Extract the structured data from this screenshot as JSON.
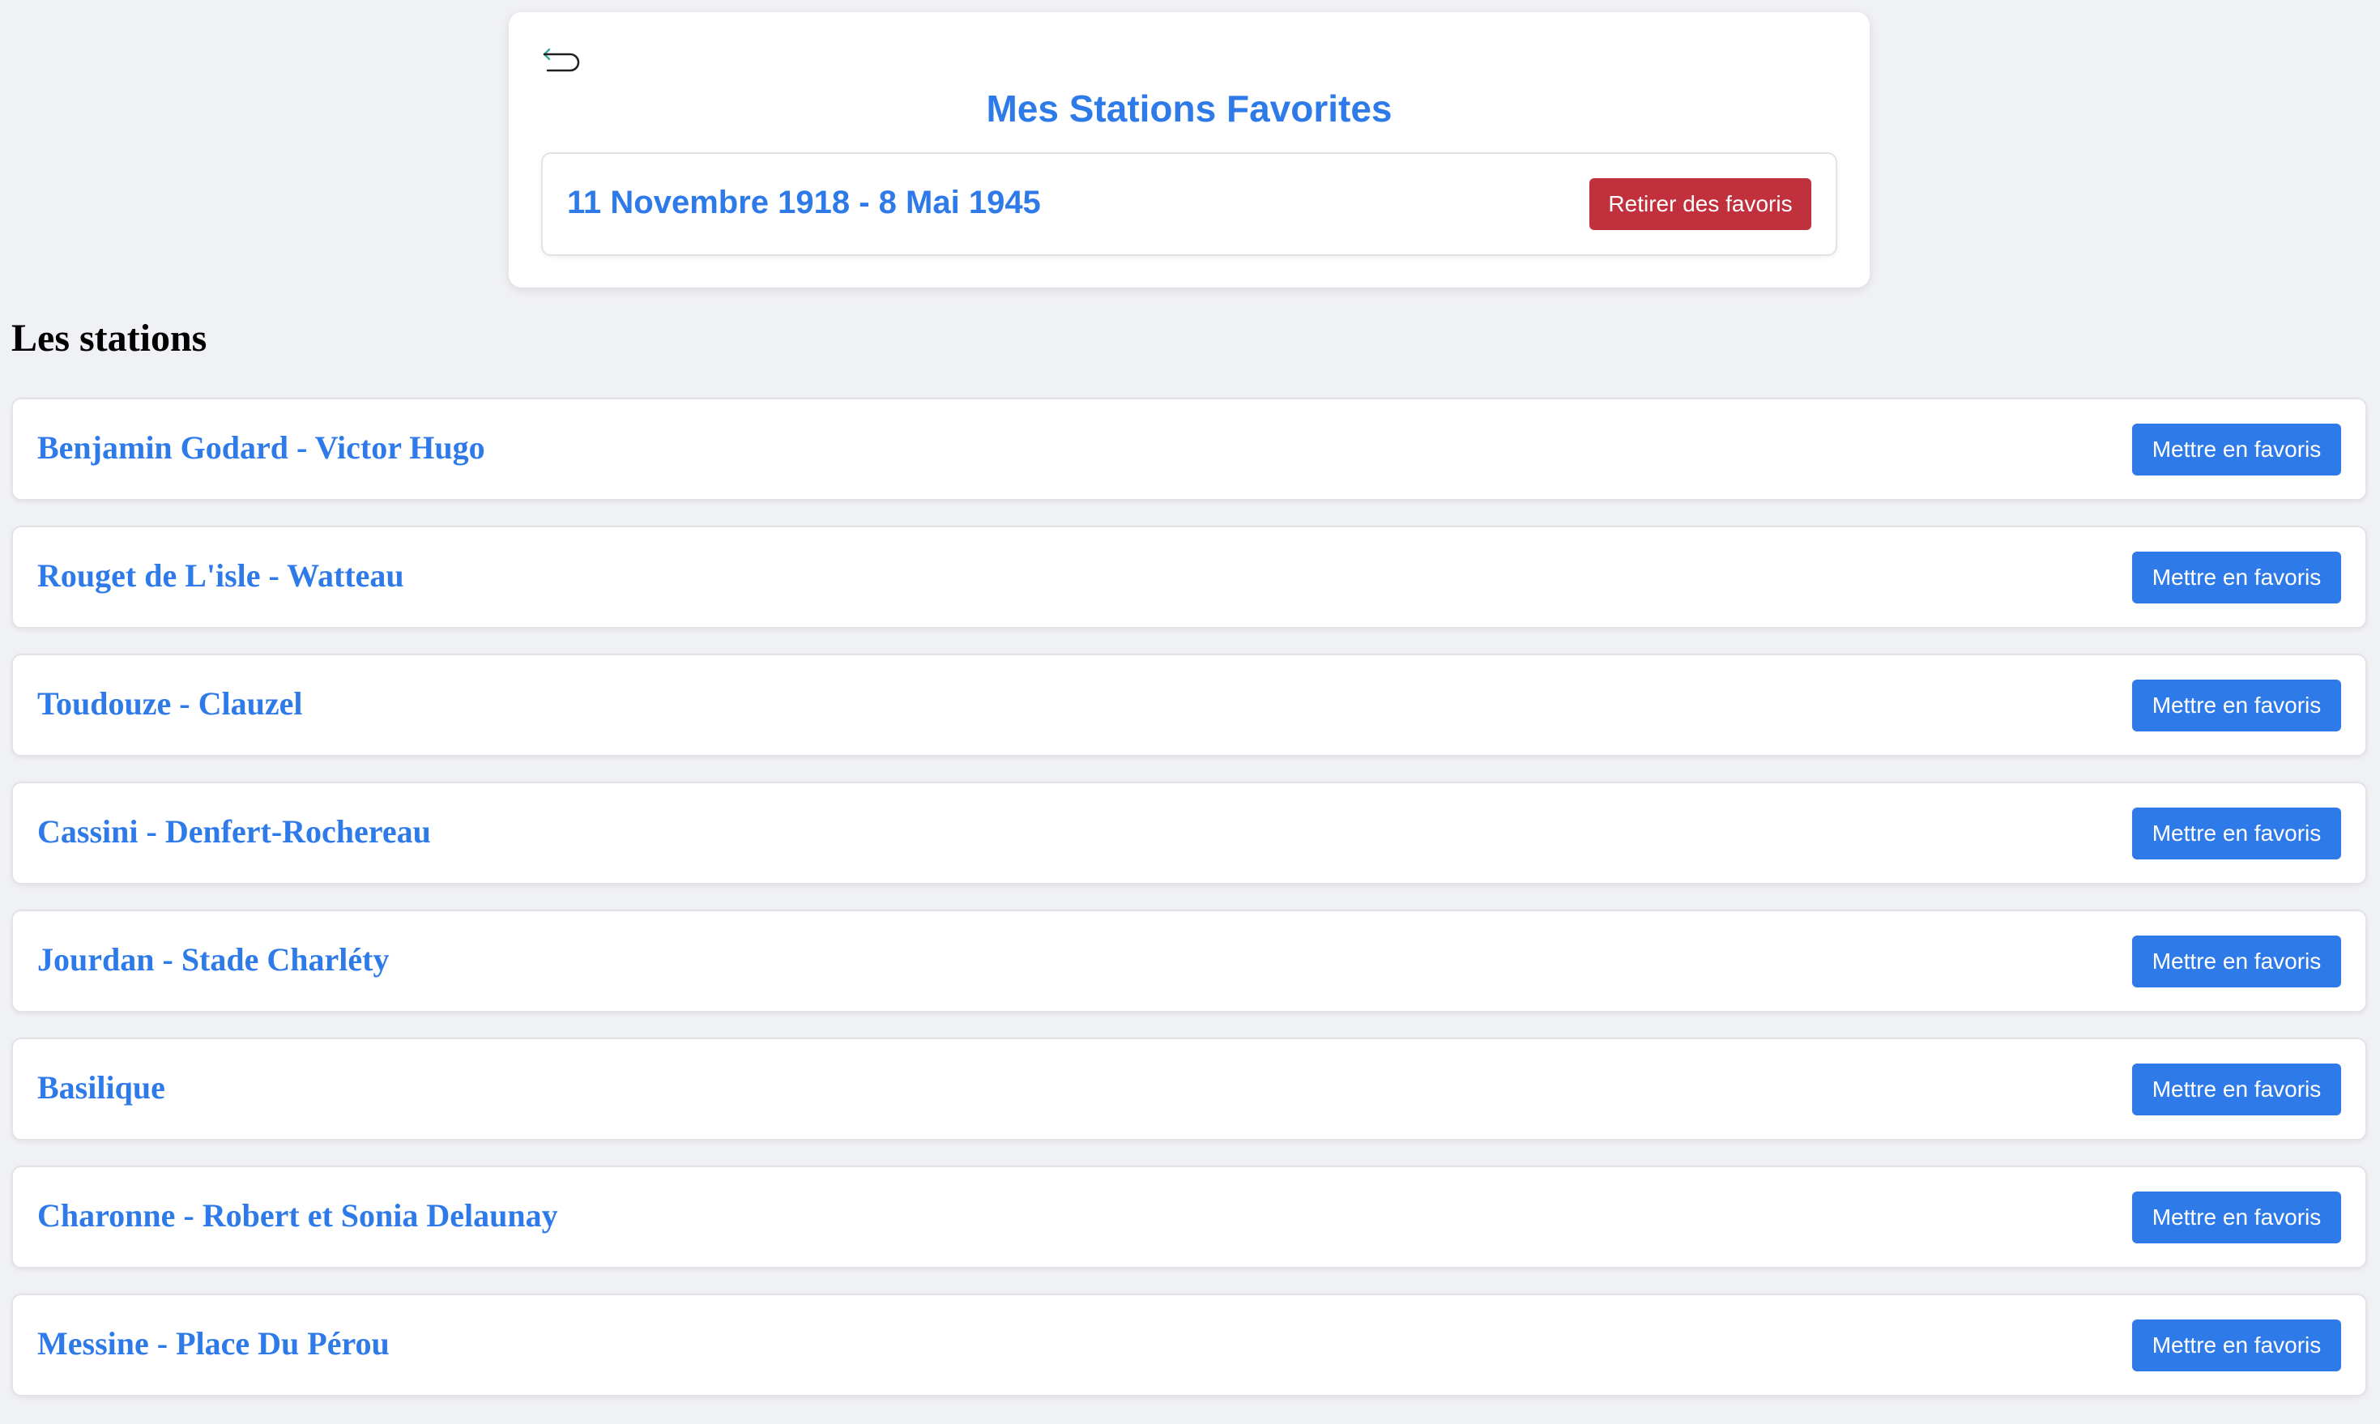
{
  "favorites_panel": {
    "back_icon": "back-arrow-icon",
    "title": "Mes Stations Favorites",
    "favorites": [
      {
        "name": "11 Novembre 1918 - 8 Mai 1945",
        "button_label": "Retirer des favoris"
      }
    ]
  },
  "stations_section": {
    "title": "Les stations",
    "items": [
      {
        "name": "Benjamin Godard - Victor Hugo",
        "button_label": "Mettre en favoris"
      },
      {
        "name": "Rouget de L'isle - Watteau",
        "button_label": "Mettre en favoris"
      },
      {
        "name": "Toudouze - Clauzel",
        "button_label": "Mettre en favoris"
      },
      {
        "name": "Cassini - Denfert-Rochereau",
        "button_label": "Mettre en favoris"
      },
      {
        "name": "Jourdan - Stade Charléty",
        "button_label": "Mettre en favoris"
      },
      {
        "name": "Basilique",
        "button_label": "Mettre en favoris"
      },
      {
        "name": "Charonne - Robert et Sonia Delaunay",
        "button_label": "Mettre en favoris"
      },
      {
        "name": "Messine - Place Du Pérou",
        "button_label": "Mettre en favoris"
      }
    ]
  },
  "colors": {
    "accent": "#2f7ae9",
    "danger": "#c1313d",
    "background": "#f0f1f4"
  }
}
